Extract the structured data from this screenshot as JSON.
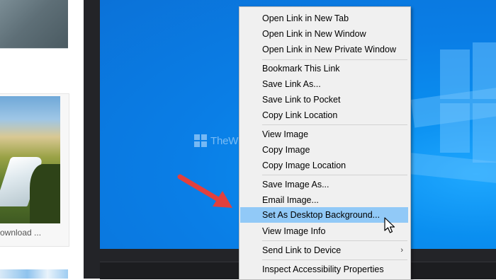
{
  "page": {
    "caption": "ownload ..."
  },
  "watermark": {
    "text": "TheWindowsClub"
  },
  "menu": {
    "groups": [
      [
        "Open Link in New Tab",
        "Open Link in New Window",
        "Open Link in New Private Window"
      ],
      [
        "Bookmark This Link",
        "Save Link As...",
        "Save Link to Pocket",
        "Copy Link Location"
      ],
      [
        "View Image",
        "Copy Image",
        "Copy Image Location"
      ],
      [
        "Save Image As...",
        "Email Image...",
        "Set As Desktop Background...",
        "View Image Info"
      ],
      [
        "Send Link to Device"
      ],
      [
        "Inspect Accessibility Properties"
      ]
    ],
    "items": {
      "open_new_tab": "Open Link in New Tab",
      "open_new_window": "Open Link in New Window",
      "open_private_window": "Open Link in New Private Window",
      "bookmark_link": "Bookmark This Link",
      "save_link_as": "Save Link As...",
      "save_link_pocket": "Save Link to Pocket",
      "copy_link_location": "Copy Link Location",
      "view_image": "View Image",
      "copy_image": "Copy Image",
      "copy_image_location": "Copy Image Location",
      "save_image_as": "Save Image As...",
      "email_image": "Email Image...",
      "set_desktop_background": "Set As Desktop Background...",
      "view_image_info": "View Image Info",
      "send_link_device": "Send Link to Device",
      "inspect_accessibility": "Inspect Accessibility Properties"
    },
    "highlighted_item": "Set As Desktop Background...",
    "submenu_arrow": "›"
  },
  "colors": {
    "highlight": "#91c9f7",
    "menu_bg": "#f0f0f0",
    "arrow": "#e2403d",
    "desktop": "#0a7ee6"
  },
  "icons": [
    "windowsclub-logo-icon",
    "red-arrow-icon",
    "mouse-cursor-icon",
    "chevron-right-icon"
  ]
}
